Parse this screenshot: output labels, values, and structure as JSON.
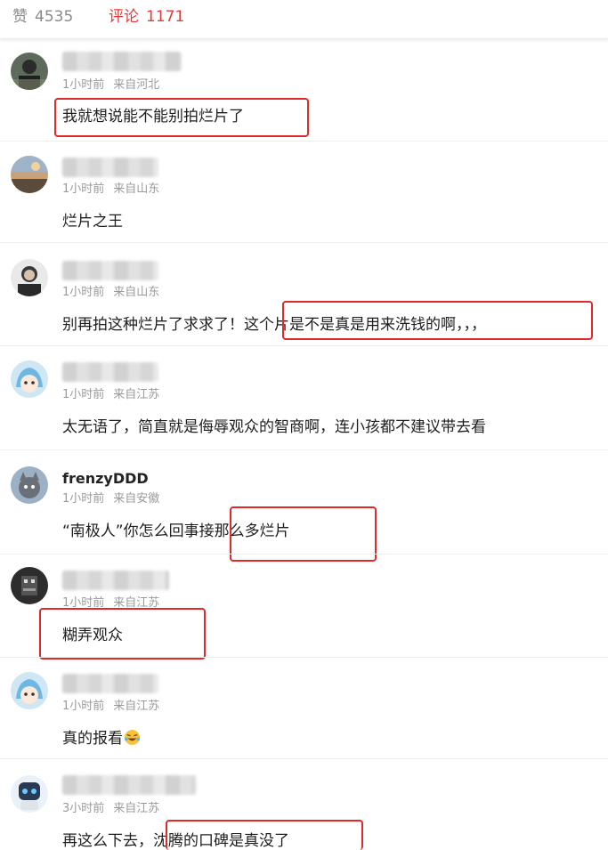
{
  "tabs": {
    "likes": {
      "label": "赞",
      "count": "4535"
    },
    "comments": {
      "label": "评论",
      "count": "1171"
    }
  },
  "comments": [
    {
      "name": "",
      "time": "1小时前",
      "location": "来自河北",
      "text": "我就想说能不能别拍烂片了"
    },
    {
      "name": "",
      "time": "1小时前",
      "location": "来自山东",
      "text": "烂片之王"
    },
    {
      "name": "",
      "time": "1小时前",
      "location": "来自山东",
      "text": "别再拍这种烂片了求求了！这个片是不是真是用来洗钱的啊，，，"
    },
    {
      "name": "",
      "time": "1小时前",
      "location": "来自江苏",
      "text": "太无语了，简直就是侮辱观众的智商啊，连小孩都不建议带去看"
    },
    {
      "name": "frenzyDDD",
      "time": "1小时前",
      "location": "来自安徽",
      "text": "“南极人”你怎么回事接那么多烂片"
    },
    {
      "name": "",
      "time": "1小时前",
      "location": "来自江苏",
      "text": "糊弄观众"
    },
    {
      "name": "",
      "time": "1小时前",
      "location": "来自江苏",
      "text": "真的报看"
    },
    {
      "name": "",
      "time": "3小时前",
      "location": "来自江苏",
      "text": "再这么下去，沈腾的口碑是真没了"
    }
  ],
  "colors": {
    "accent": "#e23a3a",
    "highlight_box": "#e02a2a",
    "meta": "#9a9a9a"
  }
}
